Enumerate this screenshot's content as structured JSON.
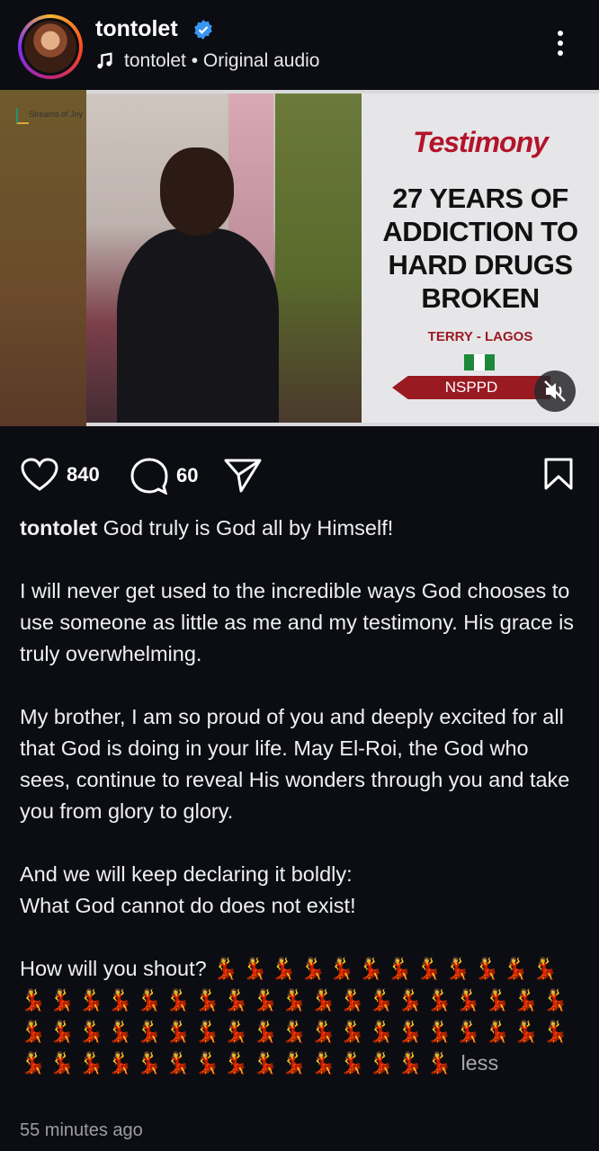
{
  "post": {
    "username": "tontolet",
    "audio": "tontolet • Original audio",
    "verified": true
  },
  "media": {
    "logo_text": "Streams of Joy",
    "title": "Testimony",
    "headline": "27 YEARS OF ADDICTION TO HARD DRUGS BROKEN",
    "location": "TERRY - LAGOS",
    "badge": "NSPPD",
    "muted": true
  },
  "actions": {
    "likes": "840",
    "comments": "60"
  },
  "caption": {
    "username": "tontolet",
    "line1": "God truly is God all by Himself!",
    "para2": "I will never get used to the incredible ways God chooses to use someone as little as me and my testimony. His grace is truly overwhelming.",
    "para3": "My brother, I am so proud of you and deeply excited for all that God is doing in your life. May El-Roi, the God who sees, continue to reveal His wonders through you and take you from glory to glory.",
    "para4_line1": "And we will keep declaring it boldly:",
    "para4_line2": "What God cannot do does not exist!",
    "shout": "How will you shout?",
    "emojis": "💃💃💃💃💃💃💃💃💃💃💃💃💃💃💃💃💃💃💃💃💃💃💃💃💃💃💃💃💃💃💃💃💃💃💃💃💃💃💃💃💃💃💃💃💃💃💃💃💃💃💃💃💃💃💃💃💃💃💃💃💃💃💃💃💃",
    "less": "less"
  },
  "timestamp": "55 minutes ago",
  "colors": {
    "background": "#0b0d12",
    "accent_red": "#b3142a",
    "verified_blue": "#3897f0"
  },
  "icons": [
    "music-note-icon",
    "verified-icon",
    "more-icon",
    "heart-icon",
    "comment-icon",
    "share-icon",
    "bookmark-icon",
    "mute-icon"
  ]
}
